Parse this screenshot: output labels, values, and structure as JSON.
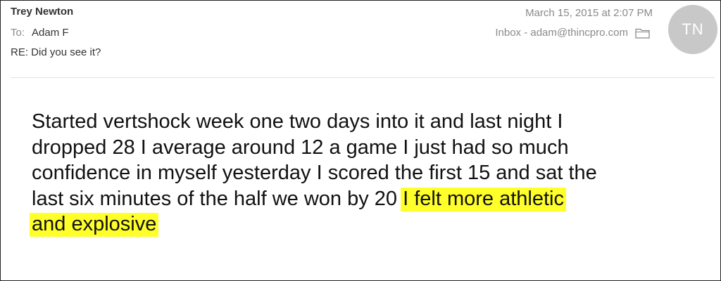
{
  "email": {
    "sender": "Trey Newton",
    "to_label": "To:",
    "to_value": "Adam F",
    "subject": "RE: Did you see it?",
    "date": "March 15, 2015 at 2:07 PM",
    "mailbox": "Inbox - adam@thincpro.com",
    "folder_icon": "folder-icon",
    "avatar_initials": "TN",
    "avatar_color": "#c8c8c8"
  },
  "message": {
    "lines": [
      "Started vertshock week one two days into it and last night I",
      "dropped 28 I average around 12 a game I just had so much",
      "confidence in myself yesterday I scored the first 15 and sat the",
      "last six minutes of the half we won by 20"
    ],
    "highlight_line1": "I felt more athletic",
    "highlight_line2": "and explosive",
    "highlight_color": "#ffff2a"
  }
}
